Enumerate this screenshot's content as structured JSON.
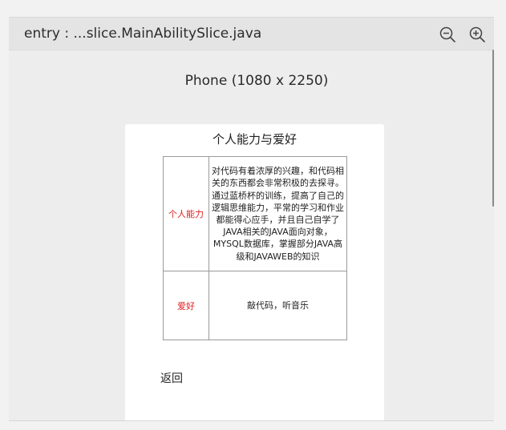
{
  "window": {
    "title": "entry : ...slice.MainAbilitySlice.java"
  },
  "toolbar": {
    "zoom_out_icon": "zoom-out-icon",
    "zoom_in_icon": "zoom-in-icon"
  },
  "device": {
    "label": "Phone (1080 x 2250)"
  },
  "page": {
    "title": "个人能力与爱好",
    "table": [
      {
        "label": "个人能力",
        "value": "对代码有着浓厚的兴趣，和代码相关的东西都会非常积极的去探寻。通过蓝桥杯的训练，提高了自己的逻辑思维能力，平常的学习和作业都能得心应手，并且自己自学了JAVA相关的JAVA面向对象，MYSQL数据库，掌握部分JAVA高级和JAVAWEB的知识"
      },
      {
        "label": "爱好",
        "value": "敲代码，听音乐"
      }
    ],
    "back_label": "返回"
  },
  "colors": {
    "label_red": "#e02020"
  }
}
